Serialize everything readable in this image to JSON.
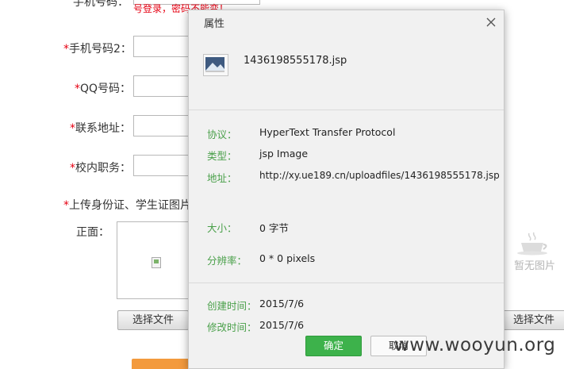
{
  "form": {
    "top_label": "手机号码：",
    "top_note": "号登录，密码不能变！",
    "required_mark": "*",
    "fields": [
      {
        "label": "手机号码2：",
        "value": ""
      },
      {
        "label": "QQ号码：",
        "value": ""
      },
      {
        "label": "联系地址：",
        "value": ""
      },
      {
        "label": "校内职务：",
        "value": ""
      }
    ],
    "upload_heading": "上传身份证、学生证图片",
    "front_label": "正面：",
    "choose_file_label": "选择文件",
    "choose_file_label_2": "选择文件",
    "no_picture_text": "暂无图片"
  },
  "dialog": {
    "title": "属性",
    "file_name": "1436198555178.jsp",
    "protocol": {
      "key": "协议：",
      "value": "HyperText Transfer Protocol"
    },
    "type": {
      "key": "类型：",
      "value": "jsp Image"
    },
    "address": {
      "key": "地址：",
      "value": "http://xy.ue189.cn/uploadfiles/1436198555178.jsp"
    },
    "size": {
      "key": "大小：",
      "value": "0 字节"
    },
    "resolution": {
      "key": "分辨率：",
      "value": "0 * 0 pixels"
    },
    "created": {
      "key": "创建时间：",
      "value": "2015/7/6"
    },
    "modified": {
      "key": "修改时间：",
      "value": "2015/7/6"
    },
    "ok_label": "确定",
    "cancel_label": "取消"
  },
  "watermark": "www.wooyun.org",
  "colors": {
    "required_red": "#e60012",
    "key_green": "#4aa04a",
    "ok_green": "#3db24b",
    "submit_orange": "#f39a3d"
  }
}
